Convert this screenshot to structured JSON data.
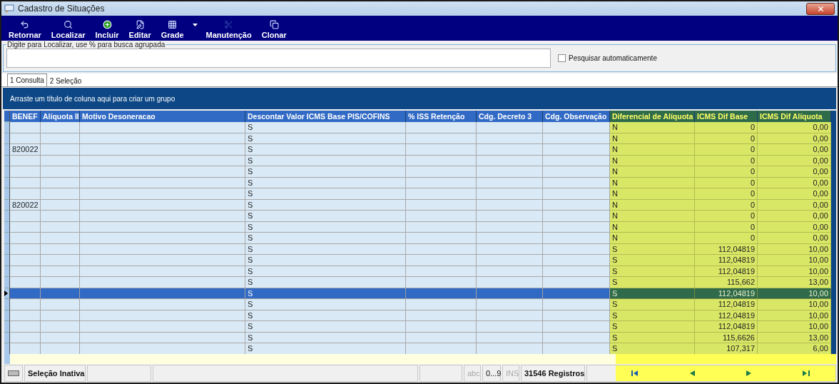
{
  "window": {
    "title": "Cadastro de Situações"
  },
  "toolbar": [
    {
      "label": "Retornar",
      "kind": "back",
      "disabled": false
    },
    {
      "label": "Localizar",
      "kind": "search",
      "disabled": false
    },
    {
      "label": "Incluir",
      "kind": "add",
      "disabled": false
    },
    {
      "label": "Editar",
      "kind": "edit",
      "disabled": false
    },
    {
      "label": "Grade",
      "kind": "grid",
      "disabled": false,
      "dropdown": true
    },
    {
      "label": "Manutenção",
      "kind": "tools",
      "disabled": true
    },
    {
      "label": "Clonar",
      "kind": "clone",
      "disabled": false
    }
  ],
  "search": {
    "legend": "Digite para Localizar, use % para busca agrupada",
    "auto_search": {
      "label": "Pesquisar automaticamente",
      "checked": false
    }
  },
  "tabs": [
    {
      "label": "1 Consulta",
      "selected": true
    },
    {
      "label": "2 Seleção",
      "selected": false
    }
  ],
  "group_panel": "Arraste um título de coluna aqui para criar um grupo",
  "table": {
    "columns": [
      {
        "label": "BENEF",
        "kind": "text",
        "highlighted": false
      },
      {
        "label": "Alíquota II",
        "kind": "text",
        "highlighted": false
      },
      {
        "label": "Motivo Desoneracao",
        "kind": "text",
        "highlighted": false
      },
      {
        "label": "Descontar Valor ICMS Base PIS/COFINS",
        "kind": "text",
        "highlighted": false
      },
      {
        "label": "% ISS Retenção",
        "kind": "text",
        "highlighted": false
      },
      {
        "label": "Cdg. Decreto 3",
        "kind": "text",
        "highlighted": false
      },
      {
        "label": "Cdg. Observação",
        "kind": "text",
        "highlighted": false
      },
      {
        "label": "Diferencial de Alíquota",
        "kind": "text",
        "highlighted": true
      },
      {
        "label": "ICMS Dif Base",
        "kind": "number",
        "highlighted": true
      },
      {
        "label": "ICMS Dif Alíquota",
        "kind": "number",
        "highlighted": true
      }
    ],
    "rows": [
      {
        "selected": false,
        "cells": [
          "",
          "",
          "",
          "S",
          "",
          "",
          "",
          "N",
          "0",
          "0,00"
        ]
      },
      {
        "selected": false,
        "cells": [
          "",
          "",
          "",
          "S",
          "",
          "",
          "",
          "N",
          "0",
          "0,00"
        ]
      },
      {
        "selected": false,
        "cells": [
          "820022",
          "",
          "",
          "S",
          "",
          "",
          "",
          "N",
          "0",
          "0,00"
        ]
      },
      {
        "selected": false,
        "cells": [
          "",
          "",
          "",
          "S",
          "",
          "",
          "",
          "N",
          "0",
          "0,00"
        ]
      },
      {
        "selected": false,
        "cells": [
          "",
          "",
          "",
          "S",
          "",
          "",
          "",
          "N",
          "0",
          "0,00"
        ]
      },
      {
        "selected": false,
        "cells": [
          "",
          "",
          "",
          "S",
          "",
          "",
          "",
          "N",
          "0",
          "0,00"
        ]
      },
      {
        "selected": false,
        "cells": [
          "",
          "",
          "",
          "S",
          "",
          "",
          "",
          "N",
          "0",
          "0,00"
        ]
      },
      {
        "selected": false,
        "cells": [
          "820022",
          "",
          "",
          "S",
          "",
          "",
          "",
          "N",
          "0",
          "0,00"
        ]
      },
      {
        "selected": false,
        "cells": [
          "",
          "",
          "",
          "S",
          "",
          "",
          "",
          "N",
          "0",
          "0,00"
        ]
      },
      {
        "selected": false,
        "cells": [
          "",
          "",
          "",
          "S",
          "",
          "",
          "",
          "N",
          "0",
          "0,00"
        ]
      },
      {
        "selected": false,
        "cells": [
          "",
          "",
          "",
          "S",
          "",
          "",
          "",
          "N",
          "0",
          "0,00"
        ]
      },
      {
        "selected": false,
        "cells": [
          "",
          "",
          "",
          "S",
          "",
          "",
          "",
          "S",
          "112,04819",
          "10,00"
        ]
      },
      {
        "selected": false,
        "cells": [
          "",
          "",
          "",
          "S",
          "",
          "",
          "",
          "S",
          "112,04819",
          "10,00"
        ]
      },
      {
        "selected": false,
        "cells": [
          "",
          "",
          "",
          "S",
          "",
          "",
          "",
          "S",
          "112,04819",
          "10,00"
        ]
      },
      {
        "selected": false,
        "cells": [
          "",
          "",
          "",
          "S",
          "",
          "",
          "",
          "S",
          "115,662",
          "13,00"
        ]
      },
      {
        "selected": true,
        "cells": [
          "",
          "",
          "",
          "S",
          "",
          "",
          "",
          "S",
          "112,04819",
          "10,00"
        ]
      },
      {
        "selected": false,
        "cells": [
          "",
          "",
          "",
          "S",
          "",
          "",
          "",
          "S",
          "112,04819",
          "10,00"
        ]
      },
      {
        "selected": false,
        "cells": [
          "",
          "",
          "",
          "S",
          "",
          "",
          "",
          "S",
          "112,04819",
          "10,00"
        ]
      },
      {
        "selected": false,
        "cells": [
          "",
          "",
          "",
          "S",
          "",
          "",
          "",
          "S",
          "112,04819",
          "10,00"
        ]
      },
      {
        "selected": false,
        "cells": [
          "",
          "",
          "",
          "S",
          "",
          "",
          "",
          "S",
          "115,6626",
          "13,00"
        ]
      },
      {
        "selected": false,
        "cells": [
          "",
          "",
          "",
          "S",
          "",
          "",
          "",
          "S",
          "107,317",
          "6,00"
        ]
      }
    ]
  },
  "status_bar": {
    "selection": "Seleção Inativa",
    "modes": [
      {
        "label": "abc",
        "active": false
      },
      {
        "label": "0...9",
        "active": true
      },
      {
        "label": "INS",
        "active": false
      }
    ],
    "count": "31546 Registros"
  }
}
